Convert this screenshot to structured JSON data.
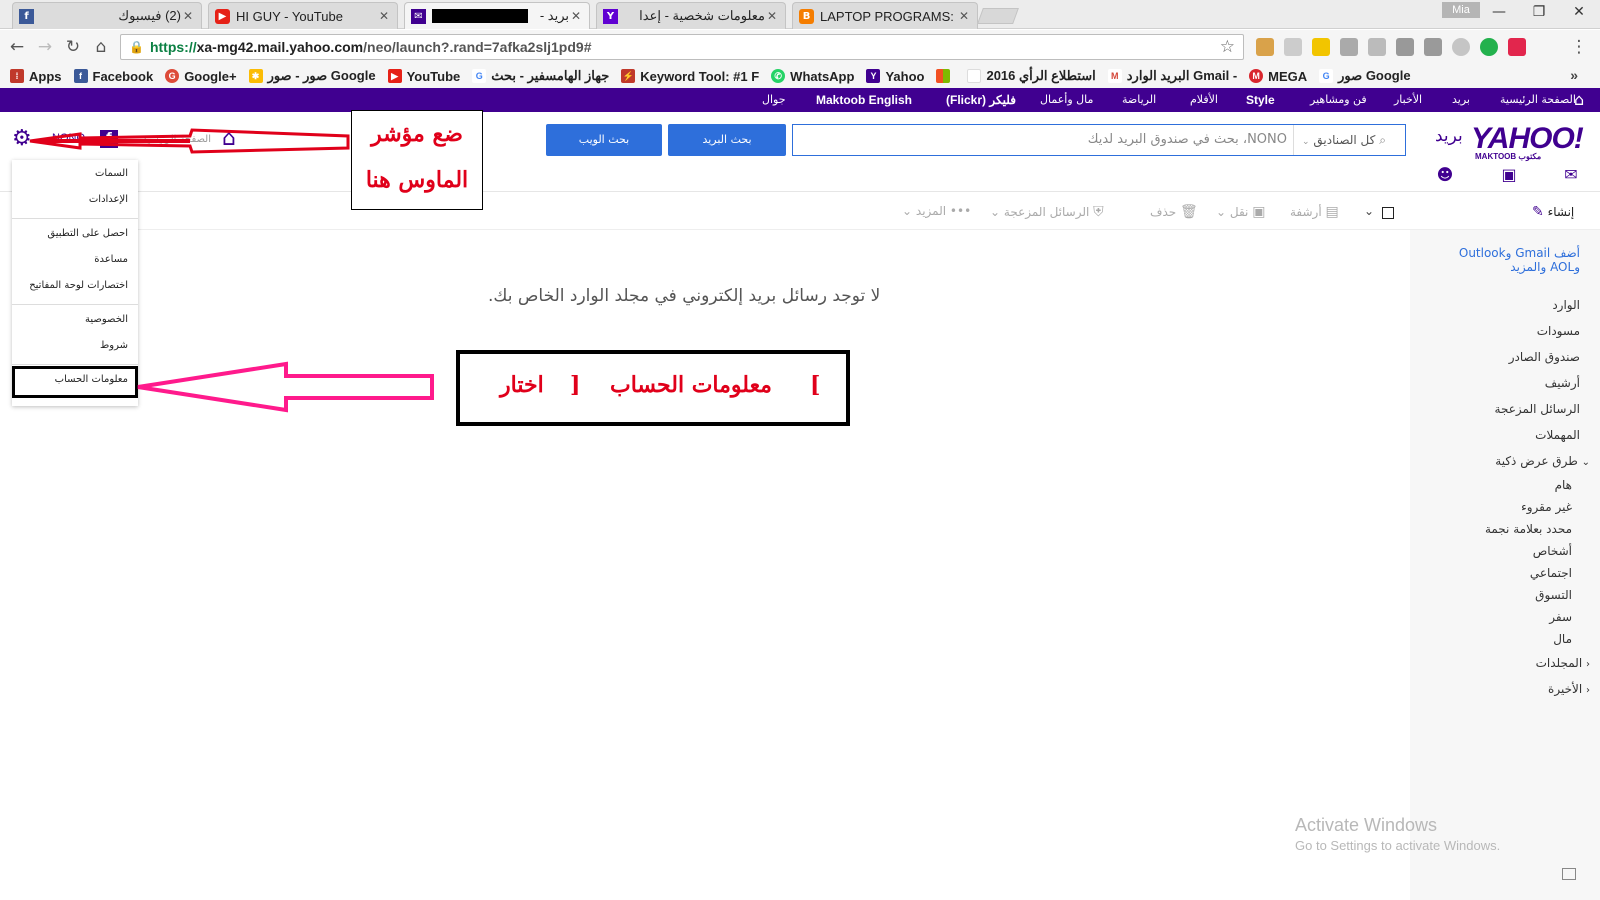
{
  "browser": {
    "tabs": [
      {
        "label": "(2) فيسبوك",
        "icon": "facebook-icon",
        "color": "#3b5998"
      },
      {
        "label": "HI GUY - YouTube",
        "icon": "youtube-icon",
        "color": "#e62117"
      },
      {
        "label": "بريد -",
        "icon": "yahoo-mail-icon",
        "color": "#400090",
        "active": true
      },
      {
        "label": "معلومات شخصية - إعدا",
        "icon": "yahoo-icon",
        "color": "#6001d2"
      },
      {
        "label": "LAPTOP PROGRAMS:",
        "icon": "blogger-icon",
        "color": "#f57d00"
      }
    ],
    "tab_close": "✕",
    "profile_name": "Mia",
    "window_controls": {
      "minimize": "—",
      "maximize": "❐",
      "close": "✕"
    },
    "url": {
      "scheme": "https://",
      "host": "xa-mg42.mail.yahoo.com",
      "path": "/neo/launch?.rand=7afka2slj1pd9#"
    },
    "bookmarks": [
      {
        "label": "Apps",
        "icon": "apps-grid-icon",
        "color": "#c0392b"
      },
      {
        "label": "Facebook",
        "icon": "facebook-icon",
        "color": "#3b5998"
      },
      {
        "label": "Google+",
        "icon": "google-plus-icon",
        "color": "#dd4b39"
      },
      {
        "label": "صور - صور Google",
        "icon": "google-photos-icon",
        "color": "#fbbc05"
      },
      {
        "label": "YouTube",
        "icon": "youtube-icon",
        "color": "#e62117"
      },
      {
        "label": "جهاز الهامسفير - بحث",
        "icon": "google-icon",
        "color": "#4285f4"
      },
      {
        "label": "Keyword Tool: #1 F",
        "icon": "keyword-tool-icon",
        "color": "#c0392b"
      },
      {
        "label": "WhatsApp",
        "icon": "whatsapp-icon",
        "color": "#25d366"
      },
      {
        "label": "Yahoo",
        "icon": "yahoo-icon",
        "color": "#400090"
      },
      {
        "label": "",
        "icon": "microsoft-icon",
        "color": "#f25022"
      },
      {
        "label": "استطلاع الرأي 2016",
        "icon": "blank-page-icon",
        "color": "#ffffff"
      },
      {
        "label": "البريد الوارد Gmail -",
        "icon": "gmail-icon",
        "color": "#d44638"
      },
      {
        "label": "MEGA",
        "icon": "mega-icon",
        "color": "#d9272e"
      },
      {
        "label": "صور Google",
        "icon": "google-icon",
        "color": "#4285f4"
      }
    ]
  },
  "yahoo_nav": [
    "الصفحة الرئيسية",
    "بريد",
    "الأخبار",
    "فن ومشاهير",
    "Style",
    "الأفلام",
    "الرياضة",
    "مال وأعمال",
    "فليكر (Flickr)",
    "Maktoob English",
    "جوال"
  ],
  "header": {
    "username": "NONO",
    "home_label": "الصفحة الرئيسية",
    "search_placeholder": "NONO، بحث في صندوق البريد لديك",
    "search_scope": "كل الصناديق",
    "search_mail_button": "بحث البريد",
    "search_web_button": "بحث الويب",
    "logo_text": "YAHOO!",
    "logo_mail": "بريد",
    "logo_sub": "MAKTOOB مكتوب"
  },
  "toolbar": {
    "compose": "إنشاء",
    "archive": "أرشفة",
    "move": "نقل",
    "delete": "حذف",
    "spam": "الرسائل المزعجة",
    "more": "المزيد"
  },
  "sidebar": {
    "add_accounts": "أضف Gmail وOutlook وAOL والمزيد",
    "folders": [
      "الوارد",
      "مسودات",
      "صندوق الصادر",
      "أرشيف",
      "الرسائل المزعجة",
      "المهملات"
    ],
    "smart_views_title": "طرق عرض ذكية",
    "smart_views": [
      "هام",
      "غير مقروء",
      "محدد بعلامة نجمة",
      "أشخاص",
      "اجتماعي",
      "التسوق",
      "سفر",
      "مال"
    ],
    "folders_title": "المجلدات",
    "recent_title": "الأخيرة"
  },
  "main": {
    "empty_message": "لا توجد رسائل بريد إلكتروني في مجلد الوارد الخاص بك."
  },
  "settings_menu": {
    "items": [
      "السمات",
      "الإعدادات",
      "احصل على التطبيق",
      "مساعدة",
      "اختصارات لوحة المفاتيح",
      "الخصوصية",
      "شروط",
      "معلومات الحساب"
    ]
  },
  "annotations": {
    "top_line1": "ضع مؤشر",
    "top_line2": "الماوس هنا",
    "mid_choose": "اختار",
    "mid_open_bracket": "[",
    "mid_item": "معلومات الحساب",
    "mid_close_bracket": "]",
    "color": "#e0001a"
  },
  "windows_watermark": {
    "line1": "Activate Windows",
    "line2": "Go to Settings to activate Windows."
  }
}
